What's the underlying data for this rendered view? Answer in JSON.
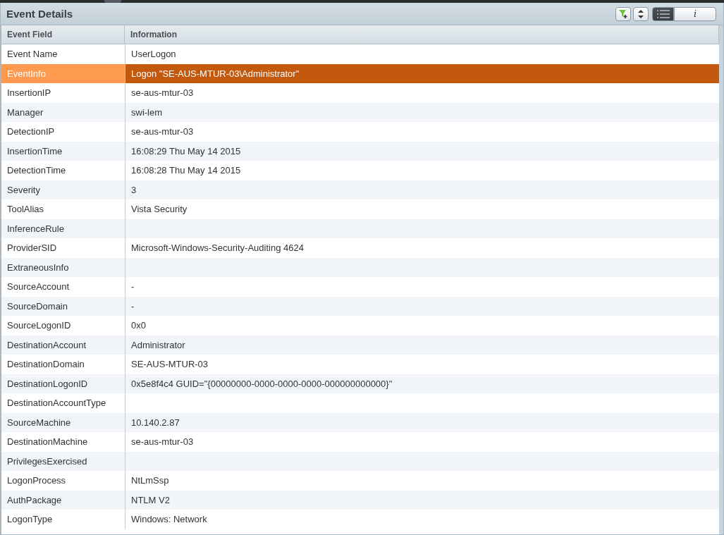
{
  "panel": {
    "title": "Event Details"
  },
  "toolbar": {
    "buttons": [
      {
        "kind": "filter-add"
      },
      {
        "kind": "sort"
      }
    ],
    "view_toggles": [
      {
        "kind": "list",
        "selected": true
      },
      {
        "kind": "info",
        "label": "i",
        "selected": false
      }
    ]
  },
  "table": {
    "columns": [
      "Event Field",
      "Information"
    ],
    "rows": [
      {
        "field": "Event Name",
        "value": "UserLogon",
        "selected": false
      },
      {
        "field": "EventInfo",
        "value": "Logon \"SE-AUS-MTUR-03\\Administrator\"",
        "selected": true
      },
      {
        "field": "InsertionIP",
        "value": "se-aus-mtur-03",
        "selected": false
      },
      {
        "field": "Manager",
        "value": "swi-lem",
        "selected": false
      },
      {
        "field": "DetectionIP",
        "value": "se-aus-mtur-03",
        "selected": false
      },
      {
        "field": "InsertionTime",
        "value": "16:08:29 Thu May 14 2015",
        "selected": false
      },
      {
        "field": "DetectionTime",
        "value": "16:08:28 Thu May 14 2015",
        "selected": false
      },
      {
        "field": "Severity",
        "value": "3",
        "selected": false
      },
      {
        "field": "ToolAlias",
        "value": "Vista Security",
        "selected": false
      },
      {
        "field": "InferenceRule",
        "selected": false
      },
      {
        "field": "ProviderSID",
        "value": "Microsoft-Windows-Security-Auditing 4624",
        "selected": false
      },
      {
        "field": "ExtraneousInfo",
        "selected": false
      },
      {
        "field": "SourceAccount",
        "value": "-",
        "selected": false
      },
      {
        "field": "SourceDomain",
        "value": "-",
        "selected": false
      },
      {
        "field": "SourceLogonID",
        "value": "0x0",
        "selected": false
      },
      {
        "field": "DestinationAccount",
        "value": "Administrator",
        "selected": false
      },
      {
        "field": "DestinationDomain",
        "value": "SE-AUS-MTUR-03",
        "selected": false
      },
      {
        "field": "DestinationLogonID",
        "value": "0x5e8f4c4 GUID=\"{00000000-0000-0000-0000-000000000000}\"",
        "selected": false
      },
      {
        "field": "DestinationAccountType",
        "selected": false
      },
      {
        "field": "SourceMachine",
        "value": "10.140.2.87",
        "selected": false
      },
      {
        "field": "DestinationMachine",
        "value": "se-aus-mtur-03",
        "selected": false
      },
      {
        "field": "PrivilegesExercised",
        "selected": false
      },
      {
        "field": "LogonProcess",
        "value": "NtLmSsp",
        "selected": false
      },
      {
        "field": "AuthPackage",
        "value": "NTLM V2",
        "selected": false
      },
      {
        "field": "LogonType",
        "value": "Windows: Network",
        "selected": false
      }
    ]
  }
}
